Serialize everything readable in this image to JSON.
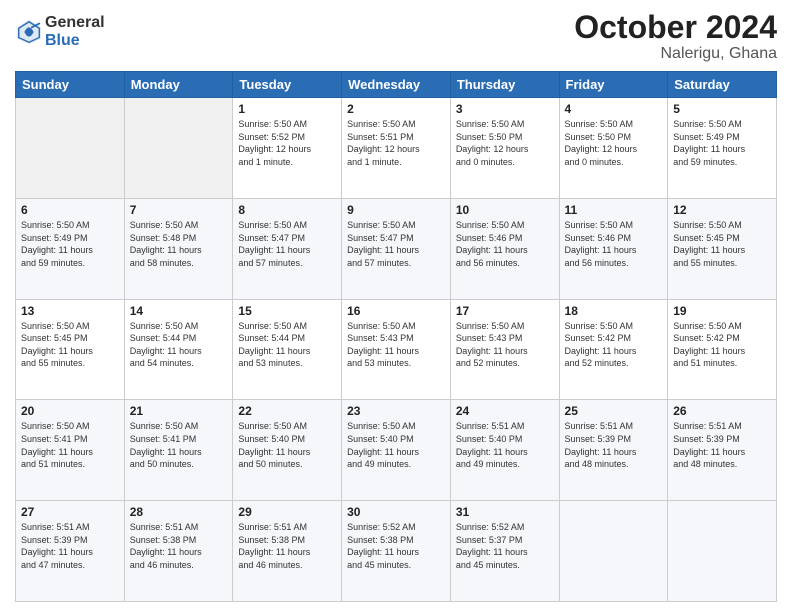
{
  "logo": {
    "general": "General",
    "blue": "Blue"
  },
  "header": {
    "month": "October 2024",
    "location": "Nalerigu, Ghana"
  },
  "weekdays": [
    "Sunday",
    "Monday",
    "Tuesday",
    "Wednesday",
    "Thursday",
    "Friday",
    "Saturday"
  ],
  "weeks": [
    [
      {
        "day": "",
        "info": ""
      },
      {
        "day": "",
        "info": ""
      },
      {
        "day": "1",
        "info": "Sunrise: 5:50 AM\nSunset: 5:52 PM\nDaylight: 12 hours\nand 1 minute."
      },
      {
        "day": "2",
        "info": "Sunrise: 5:50 AM\nSunset: 5:51 PM\nDaylight: 12 hours\nand 1 minute."
      },
      {
        "day": "3",
        "info": "Sunrise: 5:50 AM\nSunset: 5:50 PM\nDaylight: 12 hours\nand 0 minutes."
      },
      {
        "day": "4",
        "info": "Sunrise: 5:50 AM\nSunset: 5:50 PM\nDaylight: 12 hours\nand 0 minutes."
      },
      {
        "day": "5",
        "info": "Sunrise: 5:50 AM\nSunset: 5:49 PM\nDaylight: 11 hours\nand 59 minutes."
      }
    ],
    [
      {
        "day": "6",
        "info": "Sunrise: 5:50 AM\nSunset: 5:49 PM\nDaylight: 11 hours\nand 59 minutes."
      },
      {
        "day": "7",
        "info": "Sunrise: 5:50 AM\nSunset: 5:48 PM\nDaylight: 11 hours\nand 58 minutes."
      },
      {
        "day": "8",
        "info": "Sunrise: 5:50 AM\nSunset: 5:47 PM\nDaylight: 11 hours\nand 57 minutes."
      },
      {
        "day": "9",
        "info": "Sunrise: 5:50 AM\nSunset: 5:47 PM\nDaylight: 11 hours\nand 57 minutes."
      },
      {
        "day": "10",
        "info": "Sunrise: 5:50 AM\nSunset: 5:46 PM\nDaylight: 11 hours\nand 56 minutes."
      },
      {
        "day": "11",
        "info": "Sunrise: 5:50 AM\nSunset: 5:46 PM\nDaylight: 11 hours\nand 56 minutes."
      },
      {
        "day": "12",
        "info": "Sunrise: 5:50 AM\nSunset: 5:45 PM\nDaylight: 11 hours\nand 55 minutes."
      }
    ],
    [
      {
        "day": "13",
        "info": "Sunrise: 5:50 AM\nSunset: 5:45 PM\nDaylight: 11 hours\nand 55 minutes."
      },
      {
        "day": "14",
        "info": "Sunrise: 5:50 AM\nSunset: 5:44 PM\nDaylight: 11 hours\nand 54 minutes."
      },
      {
        "day": "15",
        "info": "Sunrise: 5:50 AM\nSunset: 5:44 PM\nDaylight: 11 hours\nand 53 minutes."
      },
      {
        "day": "16",
        "info": "Sunrise: 5:50 AM\nSunset: 5:43 PM\nDaylight: 11 hours\nand 53 minutes."
      },
      {
        "day": "17",
        "info": "Sunrise: 5:50 AM\nSunset: 5:43 PM\nDaylight: 11 hours\nand 52 minutes."
      },
      {
        "day": "18",
        "info": "Sunrise: 5:50 AM\nSunset: 5:42 PM\nDaylight: 11 hours\nand 52 minutes."
      },
      {
        "day": "19",
        "info": "Sunrise: 5:50 AM\nSunset: 5:42 PM\nDaylight: 11 hours\nand 51 minutes."
      }
    ],
    [
      {
        "day": "20",
        "info": "Sunrise: 5:50 AM\nSunset: 5:41 PM\nDaylight: 11 hours\nand 51 minutes."
      },
      {
        "day": "21",
        "info": "Sunrise: 5:50 AM\nSunset: 5:41 PM\nDaylight: 11 hours\nand 50 minutes."
      },
      {
        "day": "22",
        "info": "Sunrise: 5:50 AM\nSunset: 5:40 PM\nDaylight: 11 hours\nand 50 minutes."
      },
      {
        "day": "23",
        "info": "Sunrise: 5:50 AM\nSunset: 5:40 PM\nDaylight: 11 hours\nand 49 minutes."
      },
      {
        "day": "24",
        "info": "Sunrise: 5:51 AM\nSunset: 5:40 PM\nDaylight: 11 hours\nand 49 minutes."
      },
      {
        "day": "25",
        "info": "Sunrise: 5:51 AM\nSunset: 5:39 PM\nDaylight: 11 hours\nand 48 minutes."
      },
      {
        "day": "26",
        "info": "Sunrise: 5:51 AM\nSunset: 5:39 PM\nDaylight: 11 hours\nand 48 minutes."
      }
    ],
    [
      {
        "day": "27",
        "info": "Sunrise: 5:51 AM\nSunset: 5:39 PM\nDaylight: 11 hours\nand 47 minutes."
      },
      {
        "day": "28",
        "info": "Sunrise: 5:51 AM\nSunset: 5:38 PM\nDaylight: 11 hours\nand 46 minutes."
      },
      {
        "day": "29",
        "info": "Sunrise: 5:51 AM\nSunset: 5:38 PM\nDaylight: 11 hours\nand 46 minutes."
      },
      {
        "day": "30",
        "info": "Sunrise: 5:52 AM\nSunset: 5:38 PM\nDaylight: 11 hours\nand 45 minutes."
      },
      {
        "day": "31",
        "info": "Sunrise: 5:52 AM\nSunset: 5:37 PM\nDaylight: 11 hours\nand 45 minutes."
      },
      {
        "day": "",
        "info": ""
      },
      {
        "day": "",
        "info": ""
      }
    ]
  ]
}
